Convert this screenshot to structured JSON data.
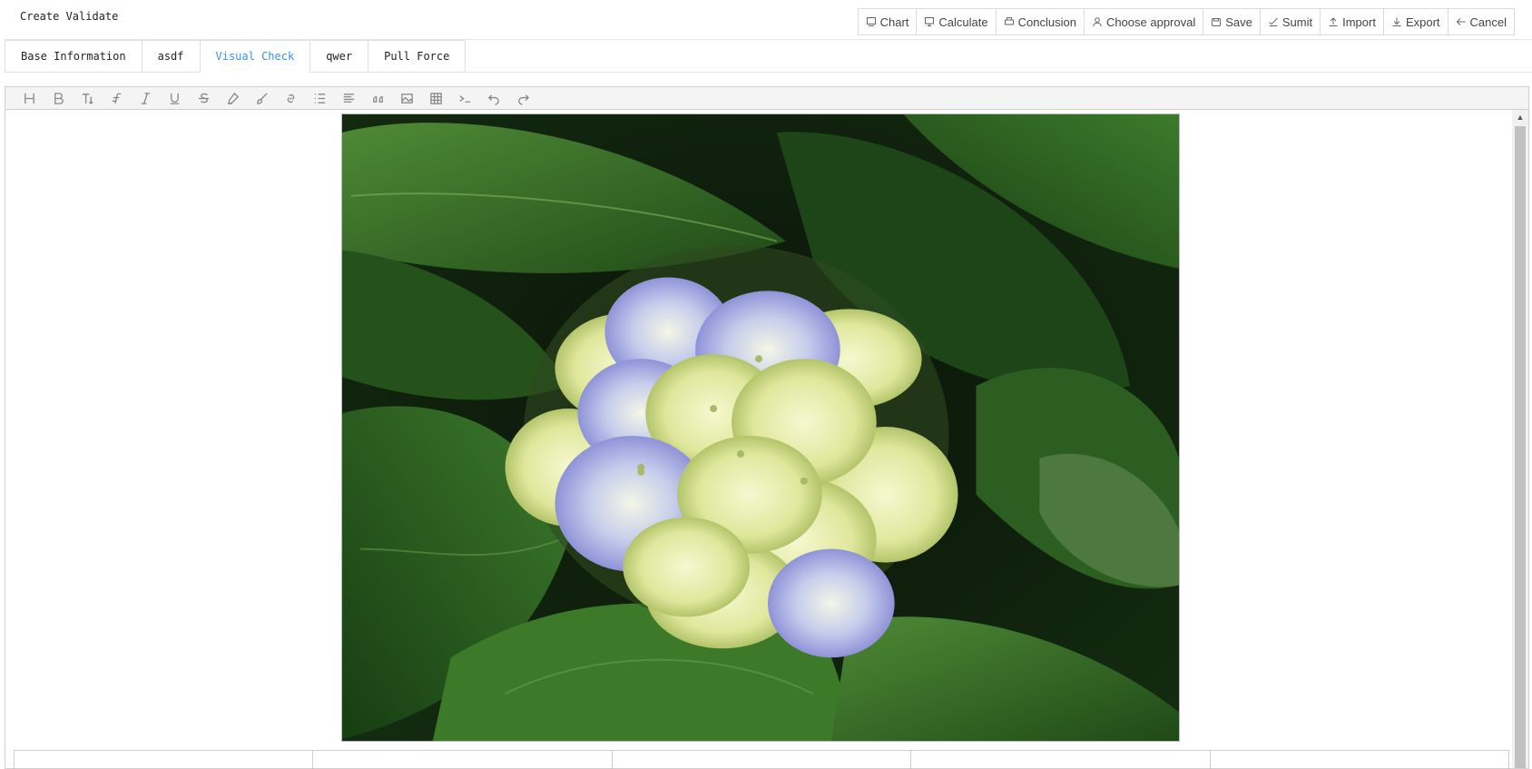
{
  "header": {
    "title": "Create Validate",
    "actions": [
      {
        "label": "Chart",
        "icon": "chart-icon"
      },
      {
        "label": "Calculate",
        "icon": "monitor-icon"
      },
      {
        "label": "Conclusion",
        "icon": "printer-icon"
      },
      {
        "label": "Choose approval",
        "icon": "user-icon"
      },
      {
        "label": "Save",
        "icon": "save-icon"
      },
      {
        "label": "Sumit",
        "icon": "send-icon"
      },
      {
        "label": "Import",
        "icon": "upload-icon"
      },
      {
        "label": "Export",
        "icon": "download-icon"
      },
      {
        "label": "Cancel",
        "icon": "arrow-left-icon"
      }
    ]
  },
  "tabs": [
    {
      "label": "Base Information",
      "active": false
    },
    {
      "label": "asdf",
      "active": false
    },
    {
      "label": "Visual Check",
      "active": true
    },
    {
      "label": "qwer",
      "active": false
    },
    {
      "label": "Pull Force",
      "active": false
    }
  ],
  "editor": {
    "toolbar": [
      "heading-icon",
      "bold-icon",
      "font-size-icon",
      "font-family-icon",
      "italic-icon",
      "underline-icon",
      "strikethrough-icon",
      "highlight-icon",
      "brush-icon",
      "link-icon",
      "bullet-list-icon",
      "align-icon",
      "quote-icon",
      "image-icon",
      "table-icon",
      "code-icon",
      "undo-icon",
      "redo-icon"
    ],
    "image_subject": "hydrangea-flower-photo"
  },
  "colors": {
    "accent": "#3a92e6",
    "border": "#dcdcdc",
    "toolbar_bg": "#f4f4f4"
  }
}
